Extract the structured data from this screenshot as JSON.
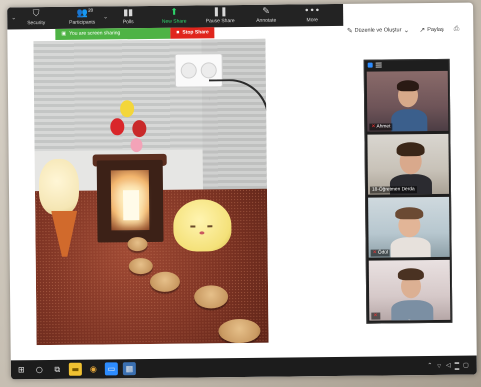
{
  "toolbar": {
    "items": [
      {
        "icon": "shield-icon",
        "label": "Security"
      },
      {
        "icon": "participants-icon",
        "label": "Participants",
        "count": "20"
      },
      {
        "icon": "polls-icon",
        "label": "Polls"
      },
      {
        "icon": "new-share-icon",
        "label": "New Share"
      },
      {
        "icon": "pause-share-icon",
        "label": "Pause Share"
      },
      {
        "icon": "annotate-icon",
        "label": "Annotate"
      },
      {
        "icon": "more-icon",
        "label": "More"
      }
    ],
    "colors": {
      "background": "#232323",
      "accent": "#2ed36a"
    }
  },
  "share_banner": {
    "sharing_text": "You are screen sharing",
    "stop_label": "Stop Share",
    "colors": {
      "green": "#4eb345",
      "red": "#e0251c"
    }
  },
  "window_controls": {
    "edit_label": "Düzenle ve Oluştur",
    "share_label": "Paylaş"
  },
  "participants": [
    {
      "name": "Ahmet"
    },
    {
      "name": "18-Öğretmen Derda"
    },
    {
      "name": "Ödül"
    },
    {
      "name": ""
    }
  ]
}
